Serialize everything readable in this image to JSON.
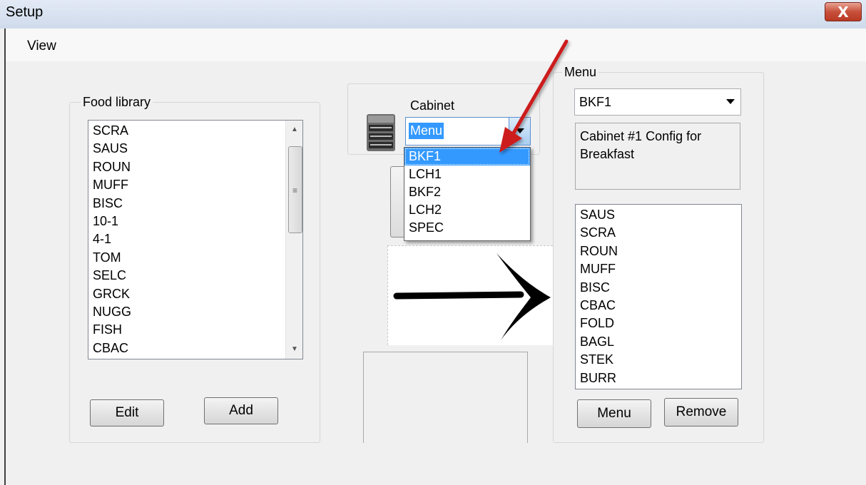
{
  "window": {
    "title": "Setup",
    "close_label": "X"
  },
  "menubar": {
    "view": "View"
  },
  "food_library": {
    "legend": "Food library",
    "items": [
      "SCRA",
      "SAUS",
      "ROUN",
      "MUFF",
      "BISC",
      "10-1",
      "4-1",
      "TOM",
      "SELC",
      "GRCK",
      "NUGG",
      "FISH",
      "CBAC"
    ],
    "edit_label": "Edit",
    "add_label": "Add"
  },
  "cabinet": {
    "legend": "Cabinet",
    "combo_value": "Menu",
    "options": [
      "BKF1",
      "LCH1",
      "BKF2",
      "LCH2",
      "SPEC"
    ],
    "highlighted": "BKF1"
  },
  "menu": {
    "legend": "Menu",
    "selected": "BKF1",
    "description": "Cabinet #1 Config for Breakfast",
    "items": [
      "SAUS",
      "SCRA",
      "ROUN",
      "MUFF",
      "BISC",
      "CBAC",
      "FOLD",
      "BAGL",
      "STEK",
      "BURR"
    ],
    "menu_button": "Menu",
    "remove_button": "Remove"
  },
  "colors": {
    "selection": "#3399ff",
    "annotation_arrow": "#cc1f1f",
    "close_button": "#c7503b"
  },
  "icons": {
    "cabinet": "cabinet-icon",
    "transfer_arrow": "right-arrow-icon",
    "pointer_arrow": "red-arrow-annotation"
  }
}
